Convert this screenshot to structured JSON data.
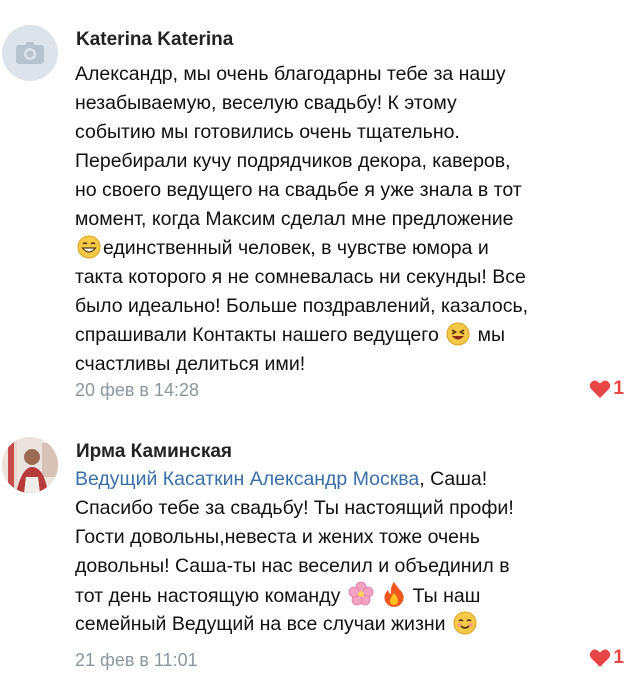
{
  "comments": [
    {
      "author": "Katerina Katerina",
      "lines": [
        "Александр, мы очень благодарны тебе за нашу",
        "незабываемую, веселую свадьбу! К этому",
        "событию мы готовились очень тщательно.",
        "Перебирали кучу подрядчиков декора, каверов,",
        "но своего ведущего на свадьбе я уже знала в тот",
        "момент, когда Максим сделал мне предложение",
        "единственный человек, в чувстве юмора и",
        "такта которого я не сомневалась ни секунды! Все",
        "было идеально! Больше поздравлений, казалось,",
        "спрашивали Контакты нашего ведущего",
        "мы",
        "счастливы делиться ими!"
      ],
      "date": "20 фев в 14:28",
      "likes": "1",
      "avatar_icon": "camera-icon",
      "emojis": [
        "grinning-face-icon",
        "laughing-face-icon"
      ]
    },
    {
      "author": "Ирма Каминская",
      "link": "Ведущий Касаткин Александр Москва",
      "lines": [
        ", Саша!",
        "Спасибо тебе за свадьбу! Ты настоящий профи!",
        "Гости довольны,невеста и жених тоже очень",
        "довольны! Саша-ты нас веселил и объединил в",
        "тот день настоящую команду",
        "Ты наш",
        "семейный Ведущий на все случаи жизни"
      ],
      "date": "21 фев в 11:01",
      "likes": "1",
      "avatar_icon": "user-photo",
      "emojis": [
        "cherry-blossom-icon",
        "fire-icon",
        "smiling-face-icon"
      ]
    }
  ],
  "colors": {
    "link": "#3a6fa8",
    "like": "#e64646",
    "date": "#8c969f"
  }
}
